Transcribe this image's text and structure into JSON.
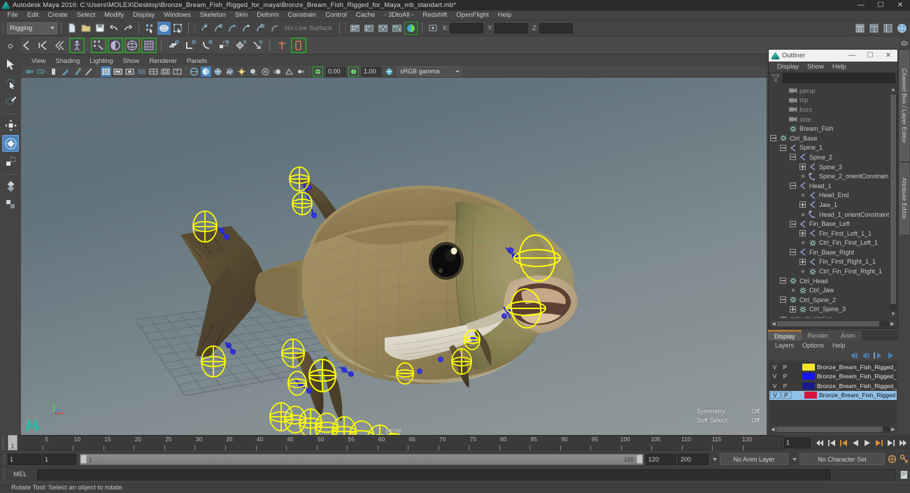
{
  "window": {
    "title": "Autodesk Maya 2016: C:\\Users\\MOLEX\\Desktop\\Bronze_Bream_Fish_Rigged_for_maya\\Bronze_Bream_Fish_Rigged_for_Maya_mb_standart.mb*",
    "minimize": "—",
    "maximize": "☐",
    "close": "✕"
  },
  "menubar": {
    "items": [
      {
        "label": "File"
      },
      {
        "label": "Edit"
      },
      {
        "label": "Create"
      },
      {
        "label": "Select"
      },
      {
        "label": "Modify"
      },
      {
        "label": "Display"
      },
      {
        "label": "Windows"
      },
      {
        "label": "Skeleton"
      },
      {
        "label": "Skin"
      },
      {
        "label": "Deform"
      },
      {
        "label": "Constrain"
      },
      {
        "label": "Control"
      },
      {
        "label": "Cache"
      },
      {
        "label": "- 3DtoAll -"
      },
      {
        "label": "Redshift"
      },
      {
        "label": "OpenFlight"
      },
      {
        "label": "Help"
      }
    ]
  },
  "statusline": {
    "mode": "Rigging",
    "live_surface": "No Live Surface",
    "axis_x_label": "X:",
    "axis_y_label": "Y:",
    "axis_z_label": "Z:",
    "axis_x_value": "",
    "axis_y_value": "",
    "axis_z_value": "",
    "icons": [
      "new-scene-icon",
      "open-scene-icon",
      "save-scene-icon",
      "undo-icon",
      "redo-icon",
      "select-by-hierarchy-icon",
      "select-by-object-icon",
      "select-by-component-icon",
      "snap-to-grid-icon",
      "snap-to-curve-icon",
      "snap-to-point-icon",
      "snap-to-projected-center-icon",
      "snap-to-view-plane-icon",
      "make-live-icon"
    ],
    "right_icons": [
      "show-hide-outliner-icon",
      "show-hide-channel-box-icon",
      "show-hide-attribute-editor-icon",
      "show-hide-tool-settings-icon"
    ]
  },
  "shelf": {
    "icons": [
      "joint-tool-icon",
      "ik-handle-tool-icon",
      "ik-spline-handle-tool-icon",
      "insert-joint-tool-icon",
      "bind-skin-icon",
      "smooth-bind-icon",
      "interactive-bind-icon",
      "paint-skin-weights-icon",
      "blend-shape-icon",
      "parent-constraint-icon",
      "point-constraint-icon",
      "orient-constraint-icon",
      "scale-constraint-icon",
      "aim-constraint-icon",
      "pole-vector-constraint-icon",
      "create-deformer-icon",
      "lattice-deformer-icon"
    ]
  },
  "toolbox": {
    "tools": [
      {
        "name": "select-tool",
        "active": false
      },
      {
        "name": "lasso-select-tool",
        "active": false
      },
      {
        "name": "paint-select-tool",
        "active": false
      },
      {
        "name": "move-tool",
        "active": false
      },
      {
        "name": "rotate-tool",
        "active": true
      },
      {
        "name": "scale-tool",
        "active": false
      },
      {
        "name": "universal-manipulator-tool",
        "active": false
      },
      {
        "name": "soft-modification-tool",
        "active": false
      }
    ]
  },
  "viewport": {
    "menu": [
      {
        "label": "View"
      },
      {
        "label": "Shading"
      },
      {
        "label": "Lighting"
      },
      {
        "label": "Show"
      },
      {
        "label": "Renderer"
      },
      {
        "label": "Panels"
      }
    ],
    "exposure_value": "0.00",
    "gamma_value": "1.00",
    "color_profile": "sRGB gamma",
    "camera_label": "persp",
    "hud": [
      {
        "label": "Symmetry:",
        "value": "Off"
      },
      {
        "label": "Soft Select:",
        "value": "Off"
      }
    ],
    "toolbar_icons": [
      "select-camera-icon",
      "lock-camera-icon",
      "camera-attributes-icon",
      "bookmark-icon",
      "add-bookmark-icon",
      "image-plane-icon",
      "grid-toggle-icon",
      "film-gate-icon",
      "resolution-gate-icon",
      "gate-mask-icon",
      "field-chart-icon",
      "safe-action-icon",
      "safe-title-icon",
      "wireframe-shaded-icon",
      "smooth-shade-all-icon",
      "shaded-wireframe-icon",
      "textured-icon",
      "use-all-lights-icon",
      "shadows-icon",
      "screen-space-ambient-occlusion-icon",
      "motion-blur-icon",
      "multisample-antialiasing-icon",
      "depth-of-field-icon",
      "exposure-icon",
      "gamma-icon",
      "color-management-icon"
    ]
  },
  "outliner": {
    "title": "Outliner",
    "menu": [
      {
        "label": "Display"
      },
      {
        "label": "Show"
      },
      {
        "label": "Help"
      }
    ],
    "search_value": "",
    "filter_icon": "filter-icon",
    "items": [
      {
        "label": "persp",
        "indent": 1,
        "toggle": "none",
        "icon": "camera-icon",
        "dim": true
      },
      {
        "label": "top",
        "indent": 1,
        "toggle": "none",
        "icon": "camera-icon",
        "dim": true
      },
      {
        "label": "front",
        "indent": 1,
        "toggle": "none",
        "icon": "camera-icon",
        "dim": true
      },
      {
        "label": "side",
        "indent": 1,
        "toggle": "none",
        "icon": "camera-icon",
        "dim": true
      },
      {
        "label": "Bream_Fish",
        "indent": 1,
        "toggle": "none",
        "icon": "transform-icon",
        "dim": false
      },
      {
        "label": "Ctrl_Base",
        "indent": 0,
        "toggle": "minus",
        "icon": "transform-icon",
        "dim": false
      },
      {
        "label": "Spine_1",
        "indent": 1,
        "toggle": "minus",
        "icon": "joint-icon",
        "dim": false
      },
      {
        "label": "Spine_2",
        "indent": 2,
        "toggle": "minus",
        "icon": "joint-icon",
        "dim": false
      },
      {
        "label": "Spine_3",
        "indent": 3,
        "toggle": "plus",
        "icon": "joint-icon",
        "dim": false
      },
      {
        "label": "Spine_2_orientConstrain",
        "indent": 3,
        "toggle": "dot",
        "icon": "constraint-icon",
        "dim": false
      },
      {
        "label": "Head_1",
        "indent": 2,
        "toggle": "minus",
        "icon": "joint-icon",
        "dim": false
      },
      {
        "label": "Head_End",
        "indent": 3,
        "toggle": "dot",
        "icon": "joint-icon",
        "dim": false
      },
      {
        "label": "Jaw_1",
        "indent": 3,
        "toggle": "plus",
        "icon": "joint-icon",
        "dim": false
      },
      {
        "label": "Head_1_orientConstraint",
        "indent": 3,
        "toggle": "dot",
        "icon": "constraint-icon",
        "dim": false
      },
      {
        "label": "Fin_Base_Left",
        "indent": 2,
        "toggle": "minus",
        "icon": "joint-icon",
        "dim": false
      },
      {
        "label": "Fin_First_Left_1_1",
        "indent": 3,
        "toggle": "plus",
        "icon": "joint-icon",
        "dim": false
      },
      {
        "label": "Ctrl_Fin_First_Left_1",
        "indent": 3,
        "toggle": "dot",
        "icon": "transform-icon",
        "dim": false
      },
      {
        "label": "Fin_Base_Right",
        "indent": 2,
        "toggle": "minus",
        "icon": "joint-icon",
        "dim": false
      },
      {
        "label": "Fin_First_Right_1_1",
        "indent": 3,
        "toggle": "plus",
        "icon": "joint-icon",
        "dim": false
      },
      {
        "label": "Ctrl_Fin_First_Right_1",
        "indent": 3,
        "toggle": "dot",
        "icon": "transform-icon",
        "dim": false
      },
      {
        "label": "Ctrl_Head",
        "indent": 1,
        "toggle": "minus",
        "icon": "transform-icon",
        "dim": false
      },
      {
        "label": "Ctrl_Jaw",
        "indent": 2,
        "toggle": "dot",
        "icon": "transform-icon",
        "dim": false
      },
      {
        "label": "Ctrl_Spine_2",
        "indent": 1,
        "toggle": "minus",
        "icon": "transform-icon",
        "dim": false
      },
      {
        "label": "Ctrl_Spine_3",
        "indent": 2,
        "toggle": "plus",
        "icon": "transform-icon",
        "dim": false
      },
      {
        "label": "defaultLightSet",
        "indent": 0,
        "toggle": "none",
        "icon": "set-icon",
        "dim": true
      }
    ]
  },
  "layer_editor": {
    "tabs": [
      {
        "label": "Display",
        "active": true
      },
      {
        "label": "Render",
        "active": false
      },
      {
        "label": "Anim",
        "active": false
      }
    ],
    "menu": [
      {
        "label": "Layers"
      },
      {
        "label": "Options"
      },
      {
        "label": "Help"
      }
    ],
    "buttons": [
      "create-empty-layer-icon",
      "create-layer-from-selected-icon",
      "move-layer-up-icon",
      "move-layer-down-icon"
    ],
    "visibility_label": "V",
    "playback_label": "P",
    "layers": [
      {
        "name": "Bronze_Bream_Fish_Rigged_control",
        "color": "#f2e52c",
        "visible": "V",
        "playback": "P",
        "selected": false
      },
      {
        "name": "Bronze_Bream_Fish_Rigged_bones",
        "color": "#1515f0",
        "visible": "V",
        "playback": "P",
        "selected": false
      },
      {
        "name": "Bronze_Bream_Fish_Rigged_helpers",
        "color": "#1a1a8a",
        "visible": "V",
        "playback": "P",
        "selected": false
      },
      {
        "name": "Bronze_Bream_Fish_Rigged",
        "color": "#d4143c",
        "visible": "V",
        "playback": "P",
        "selected": true
      }
    ]
  },
  "right_tabs": [
    {
      "label": "Channel Box / Layer Editor"
    },
    {
      "label": "Attribute Editor"
    }
  ],
  "time_slider": {
    "current_frame": "1",
    "tick_start": 1,
    "tick_end": 120,
    "tick_labels": [
      5,
      10,
      15,
      20,
      25,
      30,
      35,
      40,
      45,
      50,
      55,
      60,
      65,
      70,
      75,
      80,
      85,
      90,
      95,
      100,
      105,
      110,
      115,
      120
    ],
    "playback_buttons": [
      "go-to-start-icon",
      "step-back-keyframe-icon",
      "step-back-frame-icon",
      "play-backwards-icon",
      "play-forwards-icon",
      "step-forward-frame-icon",
      "step-forward-keyframe-icon",
      "go-to-end-icon"
    ]
  },
  "range_slider": {
    "anim_start": "1",
    "range_start": "1",
    "bar_start_label": "1",
    "bar_end_label": "120",
    "range_end": "120",
    "anim_end": "200",
    "anim_layer": "No Anim Layer",
    "character_set": "No Character Set",
    "auto_key_icon": "auto-keyframe-icon",
    "anim_prefs_icon": "animation-preferences-icon"
  },
  "command_line": {
    "language_label": "MEL",
    "input_value": "",
    "output_value": "",
    "script_editor_icon": "script-editor-icon"
  },
  "help_line": {
    "text": "Rotate Tool: Select an object to rotate."
  },
  "colors": {
    "accent_orange": "#cc7a29",
    "selection_blue": "#4d82bd",
    "control_yellow": "#ffff00",
    "bone_blue": "#2222cc",
    "panel_bg": "#444444"
  }
}
